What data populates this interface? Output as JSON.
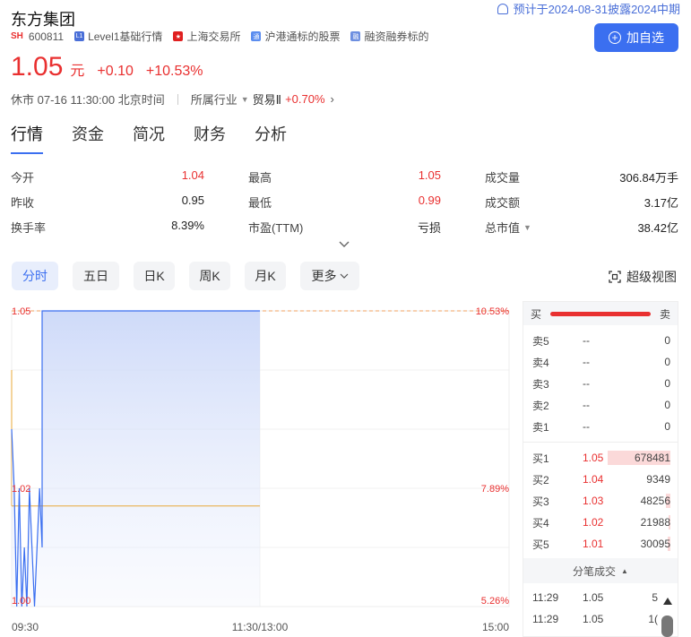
{
  "header": {
    "title": "东方集团",
    "exchange_tag": "SH",
    "code": "600811",
    "tags": [
      "Level1基础行情",
      "上海交易所",
      "沪港通标的股票",
      "融资融券标的"
    ],
    "notice": "预计于2024-08-31披露2024中期",
    "add_button": "加自选"
  },
  "quote": {
    "price": "1.05",
    "unit": "元",
    "change": "+0.10",
    "change_pct": "+10.53%",
    "status": "休市 07-16 11:30:00 北京时间",
    "industry_label": "所属行业",
    "industry": "贸易Ⅱ",
    "industry_change": "+0.70%"
  },
  "tabs": [
    "行情",
    "资金",
    "简况",
    "财务",
    "分析"
  ],
  "stats": [
    {
      "label": "今开",
      "value": "1.04",
      "color": "red"
    },
    {
      "label": "最高",
      "value": "1.05",
      "color": "red"
    },
    {
      "label": "成交量",
      "value": "306.84万手",
      "color": "normal"
    },
    {
      "label": "昨收",
      "value": "0.95",
      "color": "normal"
    },
    {
      "label": "最低",
      "value": "0.99",
      "color": "red"
    },
    {
      "label": "成交额",
      "value": "3.17亿",
      "color": "normal"
    },
    {
      "label": "换手率",
      "value": "8.39%",
      "color": "normal"
    },
    {
      "label": "市盈(TTM)",
      "value": "亏损",
      "color": "normal"
    },
    {
      "label": "总市值",
      "value": "38.42亿",
      "color": "normal"
    }
  ],
  "periods": [
    "分时",
    "五日",
    "日K",
    "周K",
    "月K",
    "更多"
  ],
  "fullscreen_label": "超级视图",
  "chart_data": {
    "type": "line",
    "y_left_ticks": [
      "1.05",
      "1.02",
      "1.00"
    ],
    "y_right_ticks": [
      "10.53%",
      "7.89%",
      "5.26%"
    ],
    "x_ticks": [
      "09:30",
      "11:30/13:00",
      "15:00"
    ],
    "ylim": [
      1.0,
      1.05
    ],
    "prev_close_line": 1.05,
    "avg_line": 1.017,
    "price_series": [
      1.03,
      1.02,
      1.0,
      1.02,
      1.0,
      1.01,
      1.0,
      1.02,
      1.01,
      1.0,
      1.01,
      1.02,
      1.01,
      1.05,
      1.05,
      1.05,
      1.05,
      1.05,
      1.05,
      1.05
    ]
  },
  "order_book": {
    "head_buy": "买",
    "head_sell": "卖",
    "asks": [
      {
        "label": "卖5",
        "price": "--",
        "volume": "0"
      },
      {
        "label": "卖4",
        "price": "--",
        "volume": "0"
      },
      {
        "label": "卖3",
        "price": "--",
        "volume": "0"
      },
      {
        "label": "卖2",
        "price": "--",
        "volume": "0"
      },
      {
        "label": "卖1",
        "price": "--",
        "volume": "0"
      }
    ],
    "bids": [
      {
        "label": "买1",
        "price": "1.05",
        "volume": "678481",
        "bar": 1.0
      },
      {
        "label": "买2",
        "price": "1.04",
        "volume": "9349",
        "bar": 0.0
      },
      {
        "label": "买3",
        "price": "1.03",
        "volume": "48256",
        "bar": 0.07
      },
      {
        "label": "买4",
        "price": "1.02",
        "volume": "21988",
        "bar": 0.03
      },
      {
        "label": "买5",
        "price": "1.01",
        "volume": "30095",
        "bar": 0.04
      }
    ],
    "trades_label": "分笔成交",
    "trades": [
      {
        "time": "11:29",
        "price": "1.05",
        "vol": "5"
      },
      {
        "time": "11:29",
        "price": "1.05",
        "vol": "1("
      }
    ]
  }
}
